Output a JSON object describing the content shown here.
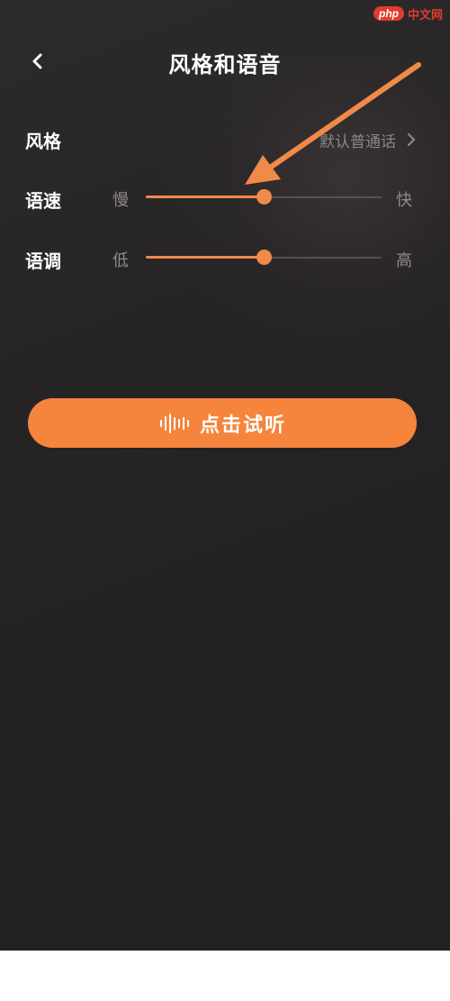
{
  "watermark": {
    "logo": "php",
    "text": "中文网"
  },
  "header": {
    "title": "风格和语音",
    "back_icon": "chevron-left-icon"
  },
  "style_row": {
    "label": "风格",
    "value": "默认普通话",
    "chevron_icon": "chevron-right-icon"
  },
  "speed_row": {
    "label": "语速",
    "min_label": "慢",
    "max_label": "快",
    "value": 0.5
  },
  "pitch_row": {
    "label": "语调",
    "min_label": "低",
    "max_label": "高",
    "value": 0.5
  },
  "listen_button": {
    "label": "点击试听",
    "icon": "sound-wave-icon"
  },
  "annotation": {
    "icon": "annotation-arrow-icon",
    "color": "#f08a48"
  },
  "colors": {
    "accent": "#f5843d",
    "slider_fill": "#f08a48",
    "background": "#242223",
    "text_primary": "#ffffff",
    "text_secondary": "#8a8686"
  }
}
